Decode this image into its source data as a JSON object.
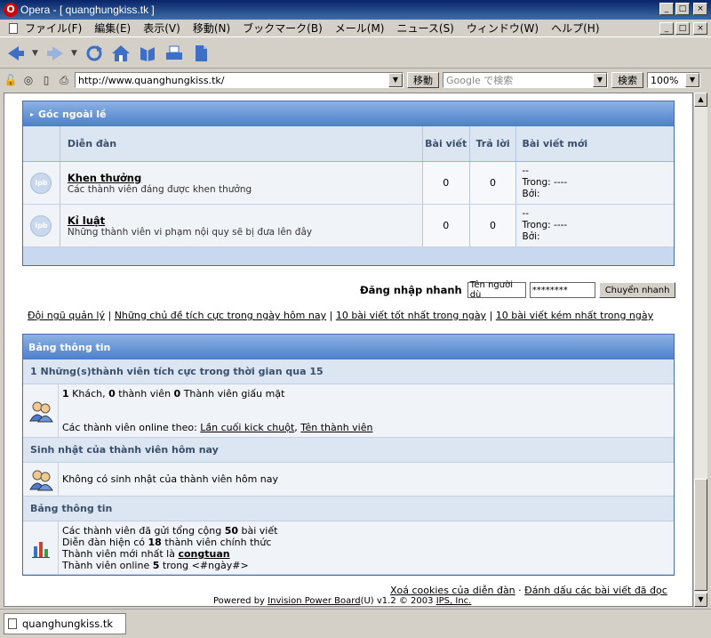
{
  "window": {
    "title": "Opera - [ quanghungkiss.tk ]",
    "app_icon": "opera-icon",
    "buttons": [
      "_",
      "□",
      "×"
    ]
  },
  "menu": {
    "items": [
      "ファイル(F)",
      "編集(E)",
      "表示(V)",
      "移動(N)",
      "ブックマーク(B)",
      "メール(M)",
      "ニュース(S)",
      "ウィンドウ(W)",
      "ヘルプ(H)"
    ]
  },
  "address": {
    "url": "http://www.quanghungkiss.tk/",
    "go_label": "移動",
    "search_placeholder": "Google で検索",
    "search_button": "検索",
    "zoom": "100%"
  },
  "forum": {
    "category": "Góc ngoài lề",
    "columns": {
      "forum": "Diễn đàn",
      "topics": "Bài viết",
      "replies": "Trả lời",
      "last": "Bài viết mới"
    },
    "rows": [
      {
        "icon": "ipb",
        "name": "Khen thưởng",
        "desc": "Các thành viên đáng được khen thưởng",
        "topics": "0",
        "replies": "0",
        "last1": "--",
        "last2": "Trong: ----",
        "last3": "Bởi:"
      },
      {
        "icon": "ipb",
        "name": "Kỉ luật",
        "desc": "Những thành viên vi phạm nội quy sẽ bị đưa lên đây",
        "topics": "0",
        "replies": "0",
        "last1": "--",
        "last2": "Trong: ----",
        "last3": "Bởi:"
      }
    ]
  },
  "login": {
    "label": "Đăng nhập nhanh",
    "username": "Tên người dù",
    "password": "********",
    "button": "Chuyển nhanh"
  },
  "links": {
    "l1": "Đội ngũ quản lý",
    "l2": "Những chủ đề tích cực trong ngày hôm nay",
    "l3": "10 bài viết tốt nhất trong ngày",
    "l4": "10 bài viết kém nhất trong ngày",
    "sep": "|"
  },
  "info": {
    "title": "Bảng thông tin",
    "active_head": "1 Những(s)thành viên tích cực trong thời gian qua 15",
    "guests": "1",
    "guests_label": "Khách,",
    "members": "0",
    "members_label": "thành viên",
    "hidden": "0",
    "hidden_label": "Thành viên giấu mặt",
    "online_by": "Các thành viên online theo:",
    "link_last_click": "Lần cuối kick chuột",
    "comma": ",",
    "link_member_name": "Tên thành viên",
    "birthday_head": "Sinh nhật của thành viên hôm nay",
    "birthday_text": "Không có sinh nhật của thành viên hôm nay",
    "stats_head": "Bảng thông tin",
    "stats1_pre": "Các thành viên đã gửi tổng cộng",
    "stats1_num": "50",
    "stats1_post": "bài viết",
    "stats2_pre": "Diễn đàn hiện có",
    "stats2_num": "18",
    "stats2_post": "thành viên chính thức",
    "stats3_pre": "Thành viên mới nhất là",
    "stats3_name": "congtuan",
    "stats4_pre": "Thành viên online",
    "stats4_num": "5",
    "stats4_post": "trong <#ngày#>"
  },
  "footer": {
    "clear_cookies": "Xoá cookies của diễn đàn",
    "dot": "·",
    "mark_read": "Đánh dấu các bài viết đã đọc",
    "powered_by": "Powered by",
    "ipb": "Invision Power Board",
    "version": "(U) v1.2 © 2003",
    "ips": "IPS, Inc."
  },
  "tab": {
    "label": "quanghungkiss.tk"
  }
}
